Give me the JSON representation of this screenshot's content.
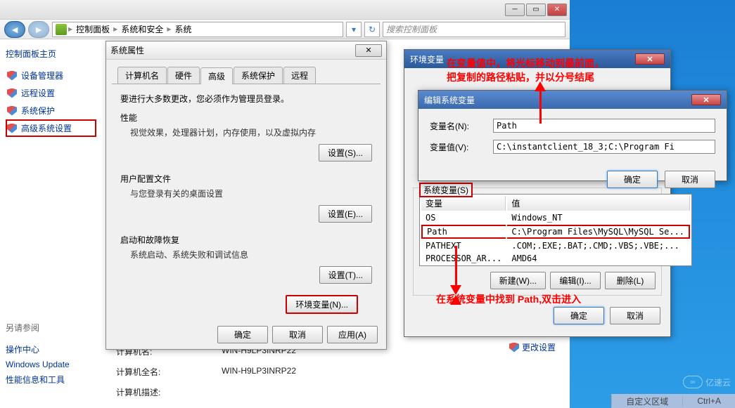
{
  "explorer": {
    "breadcrumb": [
      "控制面板",
      "系统和安全",
      "系统"
    ],
    "search_placeholder": "搜索控制面板"
  },
  "sidebar": {
    "header": "控制面板主页",
    "items": [
      "设备管理器",
      "远程设置",
      "系统保护",
      "高级系统设置"
    ],
    "see_also_header": "另请参阅",
    "see_also": [
      "操作中心",
      "Windows Update",
      "性能信息和工具"
    ]
  },
  "main": {
    "rows": [
      {
        "label": "计算机名:",
        "value": "WIN-H9LP3INRP22"
      },
      {
        "label": "计算机全名:",
        "value": "WIN-H9LP3INRP22"
      },
      {
        "label": "计算机描述:",
        "value": ""
      }
    ],
    "change_settings": "更改设置"
  },
  "sysprop": {
    "title": "系统属性",
    "tabs": [
      "计算机名",
      "硬件",
      "高级",
      "系统保护",
      "远程"
    ],
    "note": "要进行大多数更改，您必须作为管理员登录。",
    "performance": {
      "title": "性能",
      "desc": "视觉效果，处理器计划，内存使用，以及虚拟内存",
      "btn": "设置(S)..."
    },
    "userprofile": {
      "title": "用户配置文件",
      "desc": "与您登录有关的桌面设置",
      "btn": "设置(E)..."
    },
    "startup": {
      "title": "启动和故障恢复",
      "desc": "系统启动、系统失败和调试信息",
      "btn": "设置(T)..."
    },
    "env_btn": "环境变量(N)...",
    "ok": "确定",
    "cancel": "取消",
    "apply": "应用(A)"
  },
  "envvar": {
    "title": "环境变量",
    "sys_group": "系统变量(S)",
    "col_var": "变量",
    "col_val": "值",
    "rows": [
      {
        "name": "OS",
        "value": "Windows_NT"
      },
      {
        "name": "Path",
        "value": "C:\\Program Files\\MySQL\\MySQL Se..."
      },
      {
        "name": "PATHEXT",
        "value": ".COM;.EXE;.BAT;.CMD;.VBS;.VBE;..."
      },
      {
        "name": "PROCESSOR_AR...",
        "value": "AMD64"
      }
    ],
    "new_btn": "新建(W)...",
    "edit_btn": "编辑(I)...",
    "del_btn": "删除(L)",
    "ok": "确定",
    "cancel": "取消"
  },
  "editvar": {
    "title": "编辑系统变量",
    "name_label": "变量名(N):",
    "name_value": "Path",
    "value_label": "变量值(V):",
    "value_value": "C:\\instantclient_18_3;C:\\Program Fi",
    "ok": "确定",
    "cancel": "取消"
  },
  "annotations": {
    "top1": "在变量值中，将光标移动到最前面，",
    "top2": "把复制的路径粘贴，并以分号结尾",
    "bottom": "在系统变量中找到 Path,双击进入"
  },
  "bottombar": {
    "custom": "自定义区域",
    "shortcut": "Ctrl+A"
  },
  "watermark": "亿速云"
}
